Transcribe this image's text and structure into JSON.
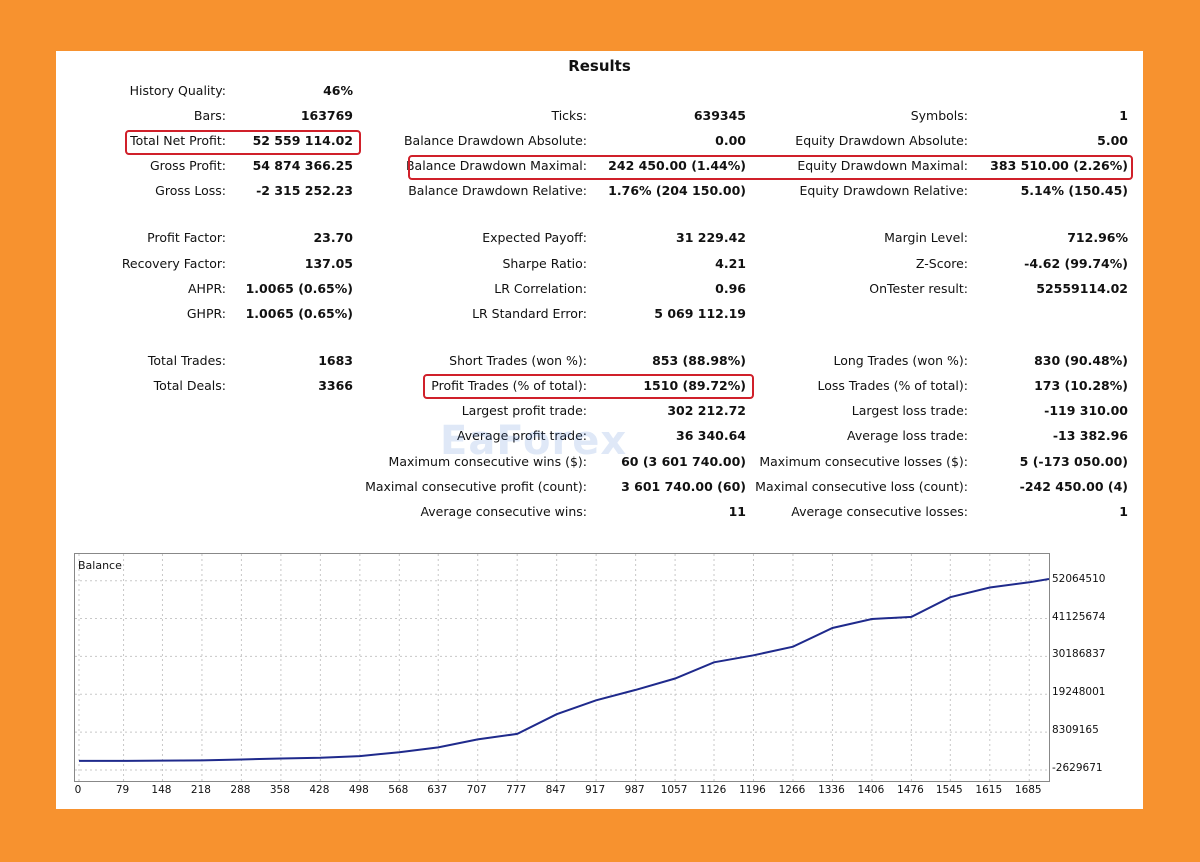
{
  "report": {
    "title": "Results",
    "col1": [
      {
        "label": "History Quality:",
        "value": "46%"
      },
      {
        "label": "Bars:",
        "value": "163769"
      },
      {
        "label": "Total Net Profit:",
        "value": "52 559 114.02"
      },
      {
        "label": "Gross Profit:",
        "value": "54 874 366.25"
      },
      {
        "label": "Gross Loss:",
        "value": "-2 315 252.23"
      },
      {
        "label": "Profit Factor:",
        "value": "23.70"
      },
      {
        "label": "Recovery Factor:",
        "value": "137.05"
      },
      {
        "label": "AHPR:",
        "value": "1.0065 (0.65%)"
      },
      {
        "label": "GHPR:",
        "value": "1.0065 (0.65%)"
      },
      {
        "label": "Total Trades:",
        "value": "1683"
      },
      {
        "label": "Total Deals:",
        "value": "3366"
      }
    ],
    "col2": [
      {
        "label": "Ticks:",
        "value": "639345"
      },
      {
        "label": "Balance Drawdown Absolute:",
        "value": "0.00"
      },
      {
        "label": "Balance Drawdown Maximal:",
        "value": "242 450.00 (1.44%)"
      },
      {
        "label": "Balance Drawdown Relative:",
        "value": "1.76% (204 150.00)"
      },
      {
        "label": "Expected Payoff:",
        "value": "31 229.42"
      },
      {
        "label": "Sharpe Ratio:",
        "value": "4.21"
      },
      {
        "label": "LR Correlation:",
        "value": "0.96"
      },
      {
        "label": "LR Standard Error:",
        "value": "5 069 112.19"
      },
      {
        "label": "Short Trades (won %):",
        "value": "853 (88.98%)"
      },
      {
        "label": "Profit Trades (% of total):",
        "value": "1510 (89.72%)"
      },
      {
        "label": "Largest profit trade:",
        "value": "302 212.72"
      },
      {
        "label": "Average profit trade:",
        "value": "36 340.64"
      },
      {
        "label": "Maximum consecutive wins ($):",
        "value": "60 (3 601 740.00)"
      },
      {
        "label": "Maximal consecutive profit (count):",
        "value": "3 601 740.00 (60)"
      },
      {
        "label": "Average consecutive wins:",
        "value": "11"
      }
    ],
    "col3": [
      {
        "label": "Symbols:",
        "value": "1"
      },
      {
        "label": "Equity Drawdown Absolute:",
        "value": "5.00"
      },
      {
        "label": "Equity Drawdown Maximal:",
        "value": "383 510.00 (2.26%)"
      },
      {
        "label": "Equity Drawdown Relative:",
        "value": "5.14% (150.45)"
      },
      {
        "label": "Margin Level:",
        "value": "712.96%"
      },
      {
        "label": "Z-Score:",
        "value": "-4.62 (99.74%)"
      },
      {
        "label": "OnTester result:",
        "value": "52559114.02"
      },
      {
        "label": "Long Trades (won %):",
        "value": "830 (90.48%)"
      },
      {
        "label": "Loss Trades (% of total):",
        "value": "173 (10.28%)"
      },
      {
        "label": "Largest loss trade:",
        "value": "-119 310.00"
      },
      {
        "label": "Average loss trade:",
        "value": "-13 382.96"
      },
      {
        "label": "Maximum consecutive losses ($):",
        "value": "5 (-173 050.00)"
      },
      {
        "label": "Maximal consecutive loss (count):",
        "value": "-242 450.00 (4)"
      },
      {
        "label": "Average consecutive losses:",
        "value": "1"
      }
    ]
  },
  "watermark": "EaForex",
  "colors": {
    "background": "#f7922f",
    "highlight": "#d0202a",
    "balance_line": "#1f2a8c"
  },
  "chart_data": {
    "type": "line",
    "title": "Balance",
    "x_ticks": [
      "0",
      "79",
      "148",
      "218",
      "288",
      "358",
      "428",
      "498",
      "568",
      "637",
      "707",
      "777",
      "847",
      "917",
      "987",
      "1057",
      "1126",
      "1196",
      "1266",
      "1336",
      "1406",
      "1476",
      "1545",
      "1615",
      "1685"
    ],
    "y_ticks": [
      "52064510",
      "41125674",
      "30186837",
      "19248001",
      "8309165",
      "-2629671"
    ],
    "xlim": [
      0,
      1720
    ],
    "ylim": [
      -2629671,
      54000000
    ],
    "grid": true,
    "series": [
      {
        "x": [
          0,
          79,
          148,
          218,
          288,
          358,
          428,
          498,
          568,
          637,
          707,
          777,
          847,
          917,
          987,
          1057,
          1126,
          1196,
          1266,
          1336,
          1406,
          1476,
          1545,
          1615,
          1685,
          1720
        ],
        "y": [
          0,
          0,
          80000,
          150000,
          400000,
          700000,
          900000,
          1400000,
          2500000,
          3900000,
          6200000,
          7800000,
          13500000,
          17500000,
          20500000,
          23800000,
          28500000,
          30500000,
          33000000,
          38400000,
          41000000,
          41600000,
          47300000,
          50100000,
          51600000,
          52559114
        ]
      }
    ]
  }
}
